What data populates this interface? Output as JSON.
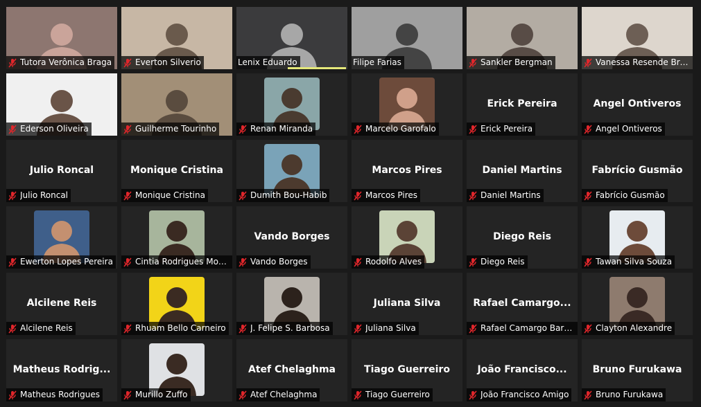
{
  "meeting": {
    "participants": [
      {
        "name": "Tutora Verônica Braga",
        "video": true,
        "bg": "#8d7670",
        "fg": "#caa49a",
        "muted": true
      },
      {
        "name": "Everton Silverio",
        "video": true,
        "bg": "#c7b7a5",
        "fg": "#6a5a4c",
        "muted": true
      },
      {
        "name": "Lenix Eduardo",
        "video": true,
        "bg": "#3b3b3d",
        "fg": "#a7a7a7",
        "muted": false,
        "speaking": true
      },
      {
        "name": "Filipe Farias",
        "video": true,
        "bg": "#9f9f9f",
        "fg": "#444",
        "muted": false,
        "active": true
      },
      {
        "name": "Sankler Bergman",
        "video": true,
        "bg": "#b3aca3",
        "fg": "#584c46",
        "muted": true
      },
      {
        "name": "Vanessa Resende Brecht",
        "video": true,
        "bg": "#ddd6cd",
        "fg": "#6d5f55",
        "muted": true
      },
      {
        "name": "Ederson Oliveira",
        "video": true,
        "bg": "#f0f0f0",
        "fg": "#6a5448",
        "muted": true
      },
      {
        "name": "Guilherme Tourinho",
        "video": true,
        "bg": "#a28f77",
        "fg": "#5a4c3f",
        "muted": true
      },
      {
        "name": "Renan Miranda",
        "photo": true,
        "bg": "#8aa6a8",
        "fg": "#4a3b30",
        "muted": true
      },
      {
        "name": "Marcelo Garofalo",
        "photo": true,
        "bg": "#6d4b3b",
        "fg": "#d0a08a",
        "muted": true
      },
      {
        "name": "Erick Pereira",
        "muted": true
      },
      {
        "name": "Angel Ontiveros",
        "muted": true
      },
      {
        "name": "Julio Roncal",
        "muted": true
      },
      {
        "name": "Monique Cristina",
        "muted": true
      },
      {
        "name": "Dumith Bou-Habib",
        "photo": true,
        "bg": "#7aa3b8",
        "fg": "#4c3a2e",
        "muted": true
      },
      {
        "name": "Marcos Pires",
        "muted": true
      },
      {
        "name": "Daniel Martins",
        "muted": true
      },
      {
        "name": "Fabrício Gusmão",
        "muted": true
      },
      {
        "name": "Ewerton Lopes Pereira",
        "photo": true,
        "bg": "#3f5f8a",
        "fg": "#c49070",
        "muted": true
      },
      {
        "name": "Cintia Rodrigues Morais",
        "photo": true,
        "bg": "#a7b59c",
        "fg": "#3a2a22",
        "muted": true
      },
      {
        "name": "Vando Borges",
        "muted": true
      },
      {
        "name": "Rodolfo Alves",
        "photo": true,
        "bg": "#c9d4b8",
        "fg": "#5b4336",
        "muted": true
      },
      {
        "name": "Diego Reis",
        "muted": true
      },
      {
        "name": "Tawan Silva Souza",
        "photo": true,
        "bg": "#e7ecf0",
        "fg": "#6d4b3a",
        "muted": true
      },
      {
        "name": "Alcilene Reis",
        "muted": true
      },
      {
        "name": "Rhuam Bello Carneiro",
        "photo": true,
        "bg": "#f2d418",
        "fg": "#3b2b22",
        "muted": true
      },
      {
        "name": "J. Felipe S. Barbosa",
        "photo": true,
        "bg": "#b9b4ad",
        "fg": "#2c221c",
        "muted": true
      },
      {
        "name": "Juliana Silva",
        "muted": true
      },
      {
        "name": "Rafael Camargo Barbosa",
        "big": "Rafael  Camargo...",
        "muted": true
      },
      {
        "name": "Clayton Alexandre",
        "photo": true,
        "bg": "#8e7b6e",
        "fg": "#3a2a25",
        "muted": true
      },
      {
        "name": "Matheus Rodrigues",
        "big": "Matheus  Rodrig...",
        "muted": true
      },
      {
        "name": "Murillo Zuffo",
        "photo": true,
        "bg": "#dfe1e4",
        "fg": "#3a2b23",
        "muted": true
      },
      {
        "name": "Atef Chelaghma",
        "muted": true
      },
      {
        "name": "Tiago Guerreiro",
        "muted": true
      },
      {
        "name": "João Francisco Amigo",
        "big": "João  Francisco...",
        "muted": true
      },
      {
        "name": "Bruno Furukawa",
        "muted": true
      }
    ]
  },
  "colors": {
    "tile_bg": "#242424",
    "page_bg": "#1a1a1a",
    "mute_red": "#e0262b",
    "active_outline": "#e5e87a"
  }
}
